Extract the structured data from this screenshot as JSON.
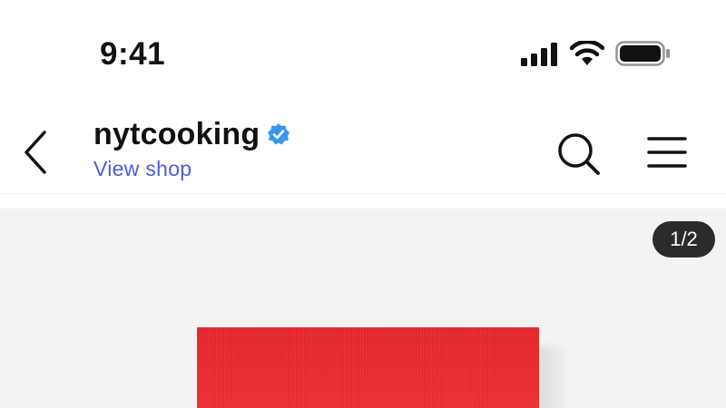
{
  "status_bar": {
    "time": "9:41",
    "icons": [
      "cellular-signal-icon",
      "wifi-icon",
      "battery-icon"
    ]
  },
  "header": {
    "back_icon": "chevron-left-icon",
    "account_name": "nytcooking",
    "verified_icon": "verified-badge-icon",
    "link_label": "View shop",
    "search_icon": "search-icon",
    "menu_icon": "hamburger-menu-icon"
  },
  "media": {
    "page_indicator": "1/2",
    "image": "red-cookbook-photo"
  },
  "colors": {
    "link": "#4f5bd5",
    "verified": "#3897f0",
    "badge_bg": "#2b2b2b",
    "book": "#e8282c"
  }
}
